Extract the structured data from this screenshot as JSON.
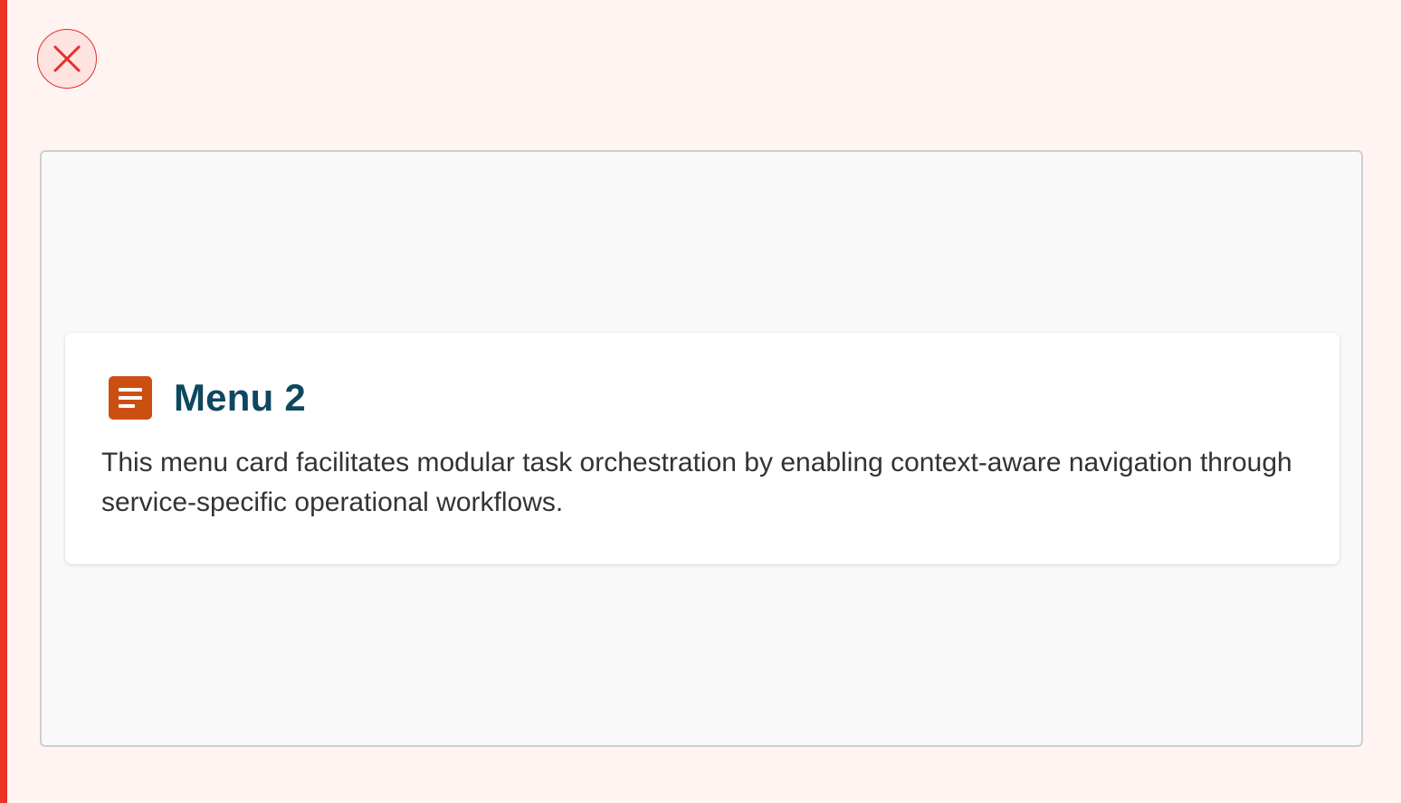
{
  "colors": {
    "accent_bar": "#ea3323",
    "close_border": "#e0312b",
    "close_bg": "#ffe3e0",
    "icon_bg": "#cc4f12",
    "title": "#0e4760"
  },
  "close": {
    "icon": "close-icon"
  },
  "card": {
    "icon": "document-lines-icon",
    "title": "Menu 2",
    "description": "This menu card facilitates modular task orchestration by enabling context-aware navigation through service-specific operational workflows."
  }
}
